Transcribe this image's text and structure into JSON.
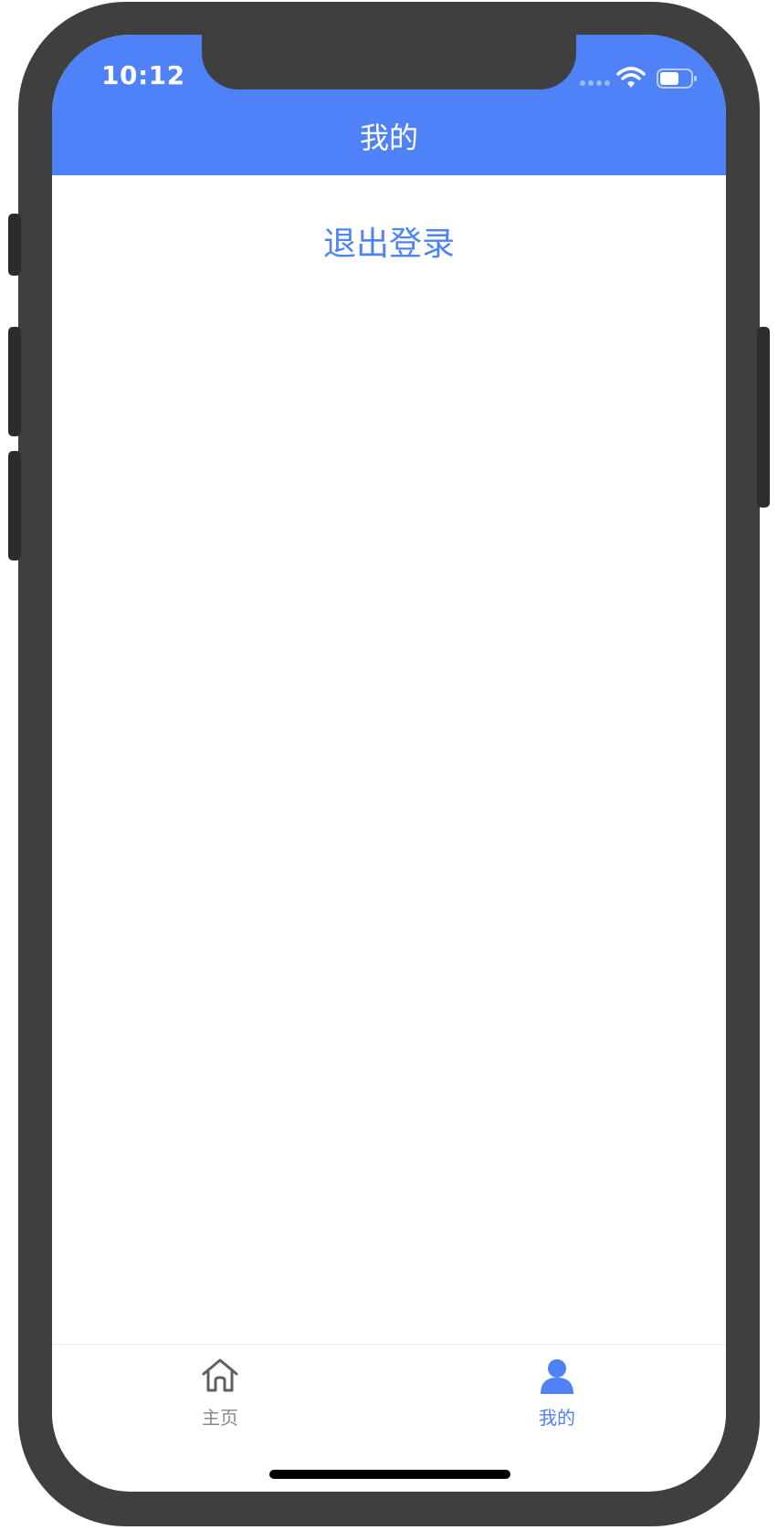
{
  "status_bar": {
    "time": "10:12",
    "icons": [
      "signal-icon",
      "wifi-icon",
      "battery-icon"
    ]
  },
  "nav": {
    "title": "我的"
  },
  "main": {
    "logout_label": "退出登录"
  },
  "tabbar": {
    "items": [
      {
        "label": "主页",
        "icon": "home-icon",
        "active": false
      },
      {
        "label": "我的",
        "icon": "user-icon",
        "active": true
      }
    ]
  },
  "colors": {
    "primary": "#4e82f6",
    "tab_inactive": "#8a8a8a",
    "device_frame": "#3f3f3f",
    "background": "#ffffff"
  }
}
